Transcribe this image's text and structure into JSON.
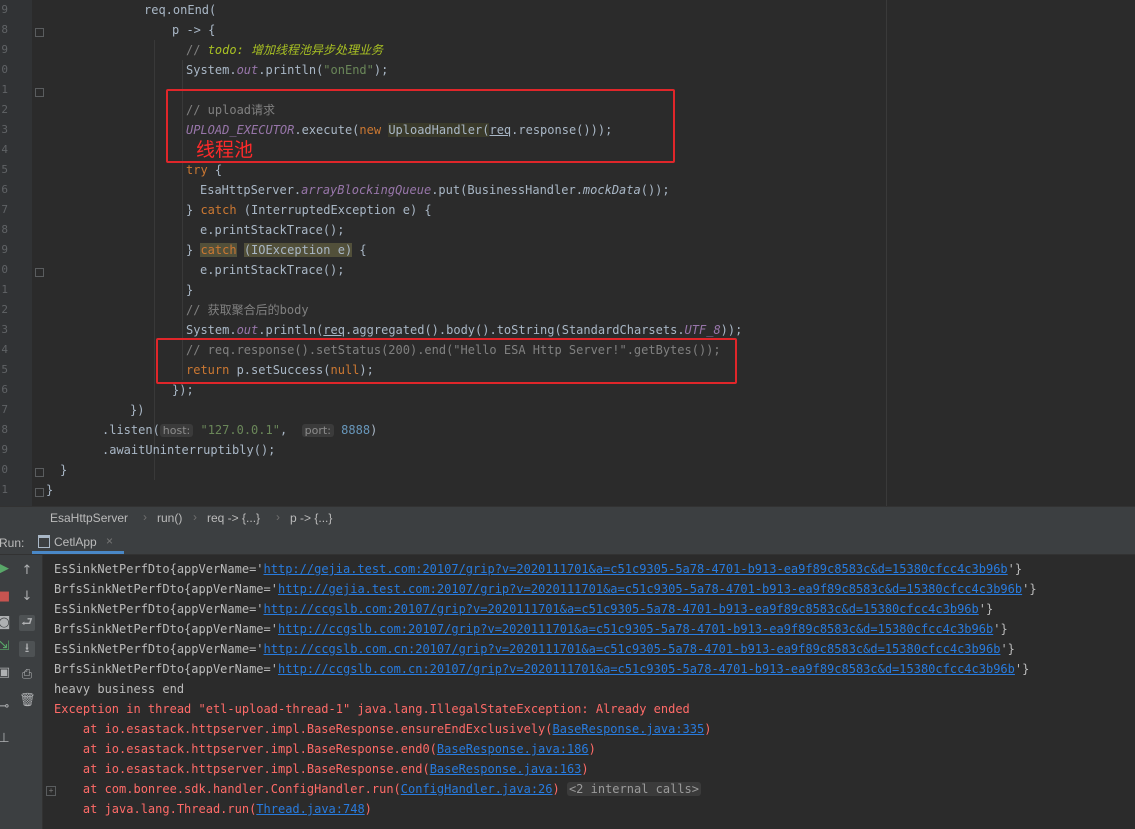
{
  "editor": {
    "gutter_line_numbers": [
      "9",
      "8",
      "9",
      "0",
      "1",
      "2",
      "3",
      "4",
      "5",
      "6",
      "7",
      "8",
      "9",
      "0",
      "1",
      "2",
      "3",
      "4",
      "5",
      "6",
      "7",
      "8",
      "9",
      "0",
      "1"
    ],
    "code_lines": [
      {
        "indent": 98,
        "text": "req.onEnd("
      },
      {
        "indent": 126,
        "text": "p -> {"
      },
      {
        "indent": 140,
        "parts": [
          {
            "c": "com",
            "t": "// "
          },
          {
            "c": "todo",
            "t": "todo: 增加线程池异步处理业务"
          }
        ]
      },
      {
        "indent": 140,
        "parts": [
          {
            "t": "System."
          },
          {
            "c": "field",
            "t": "out"
          },
          {
            "t": ".println("
          },
          {
            "c": "str",
            "t": "\"onEnd\""
          },
          {
            "t": ");"
          }
        ]
      },
      {
        "indent": 140,
        "text": ""
      },
      {
        "indent": 140,
        "parts": [
          {
            "c": "com",
            "t": "// upload请求"
          }
        ]
      },
      {
        "indent": 140,
        "parts": [
          {
            "c": "field",
            "t": "UPLOAD_EXECUTOR"
          },
          {
            "t": ".execute("
          },
          {
            "c": "kw",
            "t": "new "
          },
          {
            "c": "hl-yellow",
            "t": "UploadHandler("
          },
          {
            "c": "uline",
            "t": "req"
          },
          {
            "t": ".response()));"
          }
        ]
      },
      {
        "indent": 140,
        "text": ""
      },
      {
        "indent": 140,
        "parts": [
          {
            "c": "kw",
            "t": "try"
          },
          {
            "t": " {"
          }
        ]
      },
      {
        "indent": 154,
        "parts": [
          {
            "t": "EsaHttpServer."
          },
          {
            "c": "field",
            "t": "arrayBlockingQueue"
          },
          {
            "t": ".put(BusinessHandler."
          },
          {
            "c": "static-m",
            "t": "mockData"
          },
          {
            "t": "());"
          }
        ]
      },
      {
        "indent": 140,
        "parts": [
          {
            "t": "} "
          },
          {
            "c": "kw",
            "t": "catch"
          },
          {
            "t": " (InterruptedException e) {"
          }
        ]
      },
      {
        "indent": 154,
        "text": "e.printStackTrace();"
      },
      {
        "indent": 140,
        "parts": [
          {
            "t": "} "
          },
          {
            "c": "kw hl-catch",
            "t": "catch"
          },
          {
            "t": " "
          },
          {
            "c": "hl-catch",
            "t": "(IOException e)"
          },
          {
            "t": " {"
          }
        ]
      },
      {
        "indent": 154,
        "text": "e.printStackTrace();"
      },
      {
        "indent": 140,
        "text": "}"
      },
      {
        "indent": 140,
        "parts": [
          {
            "c": "com",
            "t": "// 获取聚合后的body"
          }
        ]
      },
      {
        "indent": 140,
        "parts": [
          {
            "t": "System."
          },
          {
            "c": "field",
            "t": "out"
          },
          {
            "t": ".println("
          },
          {
            "c": "uline",
            "t": "req"
          },
          {
            "t": ".aggregated().body().toString(StandardCharsets."
          },
          {
            "c": "field",
            "t": "UTF_8"
          },
          {
            "t": "));"
          }
        ]
      },
      {
        "indent": 140,
        "parts": [
          {
            "c": "com",
            "t": "// req.response().setStatus(200).end(\"Hello ESA Http Server!\".getBytes());"
          }
        ]
      },
      {
        "indent": 140,
        "parts": [
          {
            "c": "kw",
            "t": "return "
          },
          {
            "t": "p.setSuccess("
          },
          {
            "c": "kw",
            "t": "null"
          },
          {
            "t": ");"
          }
        ]
      },
      {
        "indent": 126,
        "text": "});"
      },
      {
        "indent": 84,
        "text": "})"
      },
      {
        "indent": 56,
        "parts": [
          {
            "t": ".listen("
          },
          {
            "c": "hint",
            "t": "host:"
          },
          {
            "t": " "
          },
          {
            "c": "str",
            "t": "\"127.0.0.1\""
          },
          {
            "t": ",  "
          },
          {
            "c": "hint",
            "t": "port:"
          },
          {
            "t": " "
          },
          {
            "c": "num",
            "t": "8888"
          },
          {
            "t": ")"
          }
        ]
      },
      {
        "indent": 56,
        "text": ".awaitUninterruptibly();"
      },
      {
        "indent": 14,
        "text": "}"
      },
      {
        "indent": 0,
        "text": "}"
      }
    ],
    "annotation_label": "线程池"
  },
  "breadcrumb": [
    "EsaHttpServer",
    "run()",
    "req -> {...}",
    "p -> {...}"
  ],
  "run_panel": {
    "label": "Run:",
    "tab_label": "CetlApp",
    "tab_close": "×"
  },
  "console_lines": [
    {
      "parts": [
        {
          "t": "EsSinkNetPerfDto{appVerName='"
        },
        {
          "c": "link",
          "t": "http://gejia.test.com:20107/grip?v=2020111701&a=c51c9305-5a78-4701-b913-ea9f89c8583c&d=15380cfcc4c3b96b"
        },
        {
          "t": "'}"
        }
      ]
    },
    {
      "parts": [
        {
          "t": "BrfsSinkNetPerfDto{appVerName='"
        },
        {
          "c": "link",
          "t": "http://gejia.test.com:20107/grip?v=2020111701&a=c51c9305-5a78-4701-b913-ea9f89c8583c&d=15380cfcc4c3b96b"
        },
        {
          "t": "'}"
        }
      ]
    },
    {
      "parts": [
        {
          "t": "EsSinkNetPerfDto{appVerName='"
        },
        {
          "c": "link",
          "t": "http://ccgslb.com:20107/grip?v=2020111701&a=c51c9305-5a78-4701-b913-ea9f89c8583c&d=15380cfcc4c3b96b"
        },
        {
          "t": "'}"
        }
      ]
    },
    {
      "parts": [
        {
          "t": "BrfsSinkNetPerfDto{appVerName='"
        },
        {
          "c": "link",
          "t": "http://ccgslb.com:20107/grip?v=2020111701&a=c51c9305-5a78-4701-b913-ea9f89c8583c&d=15380cfcc4c3b96b"
        },
        {
          "t": "'}"
        }
      ]
    },
    {
      "parts": [
        {
          "t": "EsSinkNetPerfDto{appVerName='"
        },
        {
          "c": "link",
          "t": "http://ccgslb.com.cn:20107/grip?v=2020111701&a=c51c9305-5a78-4701-b913-ea9f89c8583c&d=15380cfcc4c3b96b"
        },
        {
          "t": "'}"
        }
      ]
    },
    {
      "parts": [
        {
          "t": "BrfsSinkNetPerfDto{appVerName='"
        },
        {
          "c": "link",
          "t": "http://ccgslb.com.cn:20107/grip?v=2020111701&a=c51c9305-5a78-4701-b913-ea9f89c8583c&d=15380cfcc4c3b96b"
        },
        {
          "t": "'}"
        }
      ]
    },
    {
      "parts": [
        {
          "t": "heavy business end"
        }
      ]
    },
    {
      "err": true,
      "parts": [
        {
          "t": "Exception in thread \"etl-upload-thread-1\" java.lang.IllegalStateException: Already ended"
        }
      ]
    },
    {
      "err": true,
      "parts": [
        {
          "t": "    at io.esastack.httpserver.impl.BaseResponse.ensureEndExclusively("
        },
        {
          "c": "link",
          "t": "BaseResponse.java:335"
        },
        {
          "t": ")"
        }
      ]
    },
    {
      "err": true,
      "parts": [
        {
          "t": "    at io.esastack.httpserver.impl.BaseResponse.end0("
        },
        {
          "c": "link",
          "t": "BaseResponse.java:186"
        },
        {
          "t": ")"
        }
      ]
    },
    {
      "err": true,
      "parts": [
        {
          "t": "    at io.esastack.httpserver.impl.BaseResponse.end("
        },
        {
          "c": "link",
          "t": "BaseResponse.java:163"
        },
        {
          "t": ")"
        }
      ]
    },
    {
      "err": true,
      "parts": [
        {
          "t": "    at com.bonree.sdk.handler.ConfigHandler.run("
        },
        {
          "c": "link",
          "t": "ConfigHandler.java:26"
        },
        {
          "t": ") "
        },
        {
          "c": "ghost",
          "t": "<2 internal calls>"
        }
      ]
    },
    {
      "err": true,
      "parts": [
        {
          "t": "    at java.lang.Thread.run("
        },
        {
          "c": "link",
          "t": "Thread.java:748"
        },
        {
          "t": ")"
        }
      ]
    }
  ],
  "sidebar_icons": [
    "rerun-icon",
    "stop-icon",
    "camera-icon",
    "restore-layout-icon",
    "pin-icon",
    "scroll-up-icon",
    "scroll-down-icon",
    "soft-wrap-icon",
    "scroll-to-end-icon",
    "print-icon",
    "trash-icon"
  ],
  "colors": {
    "background": "#2b2b2b",
    "keyword": "#cc7832",
    "string": "#6a8759",
    "comment": "#808080",
    "todo": "#a8c023",
    "field": "#9876aa",
    "link": "#287bde",
    "error": "#ff6b68",
    "annotation": "#e0262a"
  }
}
